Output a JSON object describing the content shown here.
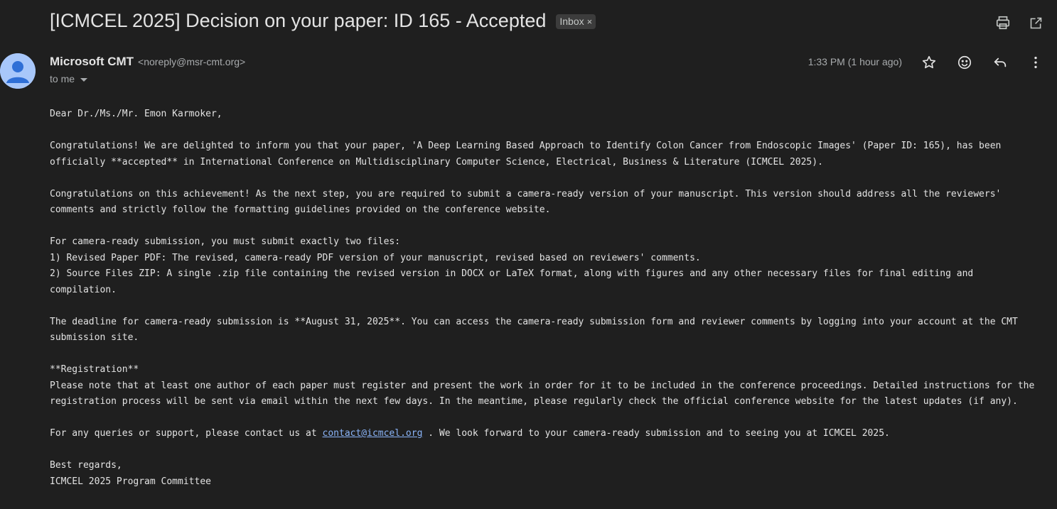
{
  "email": {
    "subject": "[ICMCEL 2025] Decision on your paper: ID 165 - Accepted",
    "label": "Inbox",
    "label_remove": "×",
    "sender_name": "Microsoft CMT",
    "sender_email": "<noreply@msr-cmt.org>",
    "recipient": "to me",
    "time": "1:33 PM (1 hour ago)",
    "icons": {
      "print": "print-icon",
      "open_new_window": "open-in-new-window-icon",
      "star": "star-icon",
      "emoji": "emoji-react-icon",
      "reply": "reply-icon",
      "more": "more-vert-icon",
      "avatar": "default-avatar-icon"
    }
  },
  "body": {
    "greeting": "Dear Dr./Ms./Mr. Emon Karmoker,",
    "para1": "Congratulations! We are delighted to inform you that your paper, 'A Deep Learning Based Approach to Identify Colon Cancer from Endoscopic Images' (Paper ID: 165), has been officially **accepted** in International Conference on Multidisciplinary Computer Science, Electrical, Business & Literature (ICMCEL 2025).",
    "para2": "Congratulations on this achievement!  As the next step, you are required to submit a camera-ready version of your manuscript. This version should address all the reviewers' comments and strictly follow the formatting guidelines provided on the conference website.",
    "files_intro": "For camera-ready submission, you must submit exactly two files:",
    "file1": "1) Revised Paper PDF: The revised, camera-ready PDF version of your manuscript, revised based on reviewers' comments.",
    "file2": "2) Source Files ZIP: A single .zip file containing the revised version in DOCX or LaTeX format, along with figures and any other necessary files for final editing and compilation.",
    "deadline": "The deadline for camera-ready submission is **August 31, 2025**. You can access the camera-ready submission form and reviewer comments by logging into your account at the CMT submission site.",
    "registration_heading": "**Registration**",
    "registration_text": "Please note that at least one author of each paper must register and present the work in order for it to be included in the conference proceedings. Detailed instructions for the registration process will be sent via email within the next few days. In the meantime, please regularly check the official conference website for the latest updates (if any).",
    "contact_prefix": "For any queries or support, please contact us at ",
    "contact_link": "contact@icmcel.org",
    "contact_suffix": " . We look forward to your camera-ready submission and to seeing you at ICMCEL 2025.",
    "closing": "Best regards,",
    "signature": "ICMCEL 2025 Program Committee"
  }
}
